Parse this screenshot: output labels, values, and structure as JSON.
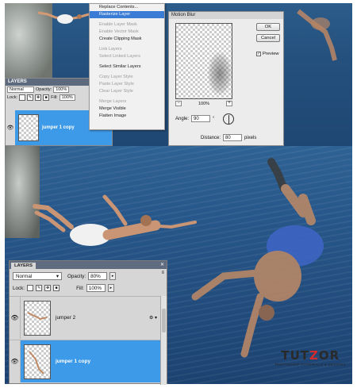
{
  "context_menu": {
    "items": [
      {
        "label": "Replace Contents...",
        "state": "normal"
      },
      {
        "label": "Rasterize Layer",
        "state": "highlighted"
      },
      {
        "label": "",
        "state": "separator"
      },
      {
        "label": "Enable Layer Mask",
        "state": "disabled"
      },
      {
        "label": "Enable Vector Mask",
        "state": "disabled"
      },
      {
        "label": "Create Clipping Mask",
        "state": "normal"
      },
      {
        "label": "",
        "state": "separator"
      },
      {
        "label": "Link Layers",
        "state": "disabled"
      },
      {
        "label": "Select Linked Layers",
        "state": "disabled"
      },
      {
        "label": "",
        "state": "separator"
      },
      {
        "label": "Select Similar Layers",
        "state": "normal"
      },
      {
        "label": "",
        "state": "separator"
      },
      {
        "label": "Copy Layer Style",
        "state": "disabled"
      },
      {
        "label": "Paste Layer Style",
        "state": "disabled"
      },
      {
        "label": "Clear Layer Style",
        "state": "disabled"
      },
      {
        "label": "",
        "state": "separator"
      },
      {
        "label": "Merge Layers",
        "state": "disabled"
      },
      {
        "label": "Merge Visible",
        "state": "normal"
      },
      {
        "label": "Flatten Image",
        "state": "normal"
      }
    ]
  },
  "motion_blur": {
    "title": "Motion Blur",
    "ok_label": "OK",
    "cancel_label": "Cancel",
    "preview_label": "Preview",
    "preview_checked": true,
    "zoom_value": "100%",
    "zoom_out": "−",
    "zoom_in": "+",
    "angle_label": "Angle:",
    "angle_value": "90",
    "angle_unit": "°",
    "distance_label": "Distance:",
    "distance_value": "80",
    "distance_unit": "pixels"
  },
  "layers_small": {
    "title": "LAYERS",
    "blend_mode": "Normal",
    "opacity_label": "Opacity:",
    "opacity_value": "100%",
    "lock_label": "Lock:",
    "fill_label": "Fill:",
    "fill_value": "100%",
    "layer_name": "jumper 1 copy"
  },
  "layers_big": {
    "tab_label": "LAYERS",
    "close_glyph": "✕",
    "menu_glyph": "≡",
    "blend_mode": "Normal",
    "opacity_label": "Opacity:",
    "opacity_value": "80%",
    "lock_label": "Lock:",
    "fill_label": "Fill:",
    "fill_value": "100%",
    "layers": [
      {
        "name": "jumper 2",
        "selected": false
      },
      {
        "name": "jumper 1 copy",
        "selected": true
      }
    ]
  },
  "watermark": {
    "logo_left": "TUT",
    "logo_mid": "Z",
    "logo_right": "OR",
    "tagline": "PHOTOSHOP TUTORIALS & DESIGNS"
  },
  "colors": {
    "selection_blue": "#3d9ae8",
    "menu_highlight": "#3a7bd5",
    "sea": "#24507d",
    "panel_grey": "#d6d6d6"
  }
}
